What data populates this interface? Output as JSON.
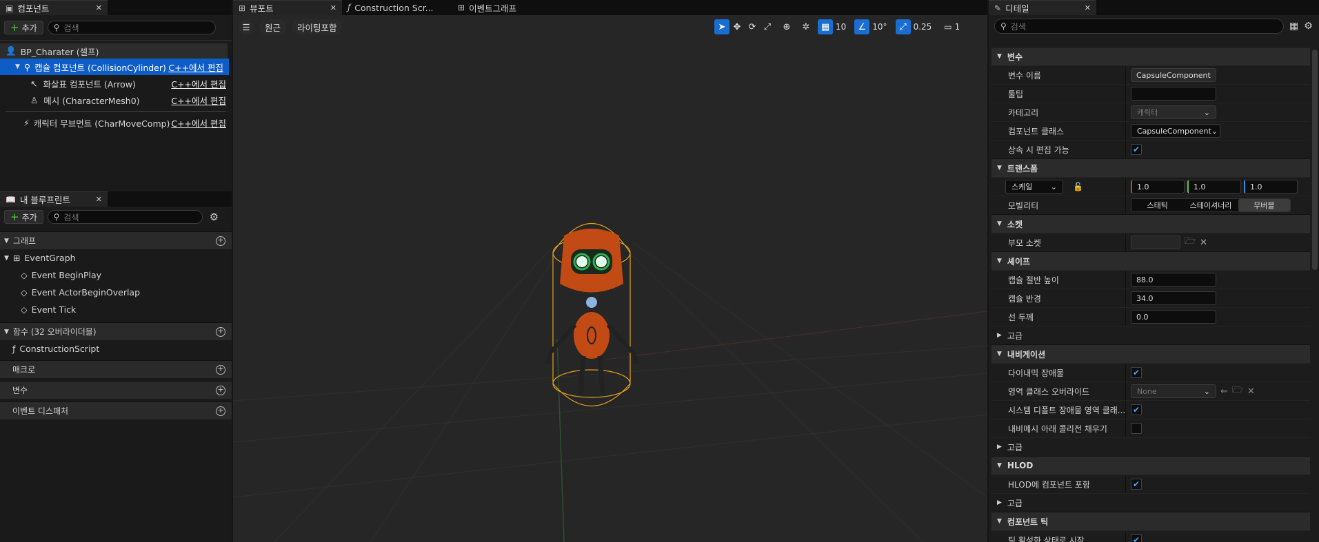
{
  "components_panel": {
    "tab_title": "컴포넌트",
    "add_label": "추가",
    "search_placeholder": "검색",
    "root": "BP_Charater (셀프)",
    "items": [
      {
        "label": "캡슐 컴포넌트 (CollisionCylinder)",
        "edit": "C++에서 편집",
        "selected": true
      },
      {
        "label": "화살표 컴포넌트 (Arrow)",
        "edit": "C++에서 편집"
      },
      {
        "label": "메시 (CharacterMesh0)",
        "edit": "C++에서 편집"
      },
      {
        "label": "캐릭터 무브먼트 (CharMoveComp)",
        "edit": "C++에서 편집"
      }
    ]
  },
  "blueprint_panel": {
    "tab_title": "내 블루프린트",
    "add_label": "추가",
    "search_placeholder": "검색",
    "graphs_header": "그래프",
    "event_graph": "EventGraph",
    "events": [
      "Event BeginPlay",
      "Event ActorBeginOverlap",
      "Event Tick"
    ],
    "functions_header": "함수 (32 오버라이더블)",
    "construction_script": "ConstructionScript",
    "macros_header": "매크로",
    "variables_header": "변수",
    "dispatchers_header": "이벤트 디스패처"
  },
  "editor_tabs": {
    "viewport": "뷰포트",
    "construction": "Construction Scr...",
    "event_graph": "이벤트그래프"
  },
  "viewport_toolbar": {
    "perspective": "원근",
    "lighting": "라이팅포함",
    "grid_snap": "10",
    "rot_snap": "10°",
    "scale_snap": "0.25",
    "camera_speed": "1"
  },
  "details": {
    "tab_title": "디테일",
    "search_placeholder": "검색",
    "sections": {
      "variable": "변수",
      "transform": "트랜스폼",
      "sockets": "소켓",
      "shape": "셰이프",
      "advanced": "고급",
      "navigation": "내비게이션",
      "hlod": "HLOD",
      "component_tick": "컴포넌트 틱"
    },
    "var_name_label": "변수 이름",
    "var_name_value": "CapsuleComponent",
    "tooltip_label": "툴팁",
    "category_label": "카테고리",
    "category_value": "캐릭터",
    "component_class_label": "컴포넌트 클래스",
    "component_class_value": "CapsuleComponent",
    "editable_inherit_label": "상속 시 편집 가능",
    "scale_combo": "스케일",
    "scale_x": "1.0",
    "scale_y": "1.0",
    "scale_z": "1.0",
    "mobility_label": "모빌리티",
    "mobility_options": [
      "스태틱",
      "스테이셔너리",
      "무버블"
    ],
    "parent_socket_label": "부모 소켓",
    "half_height_label": "캡슐 절반 높이",
    "half_height_value": "88.0",
    "radius_label": "캡슐 반경",
    "radius_value": "34.0",
    "line_thickness_label": "선 두께",
    "line_thickness_value": "0.0",
    "dynamic_obstacle_label": "다이내믹 장애물",
    "area_class_label": "영역 클래스 오버라이드",
    "area_class_value": "None",
    "sys_default_label": "시스템 디폴트 장애물 영역 클래...",
    "fill_collision_label": "내비메시 아래 콜리전 채우기",
    "hlod_include_label": "HLOD에 컴포넌트 포함",
    "tick_start_label": "틱 활성화 상태로 시작"
  }
}
